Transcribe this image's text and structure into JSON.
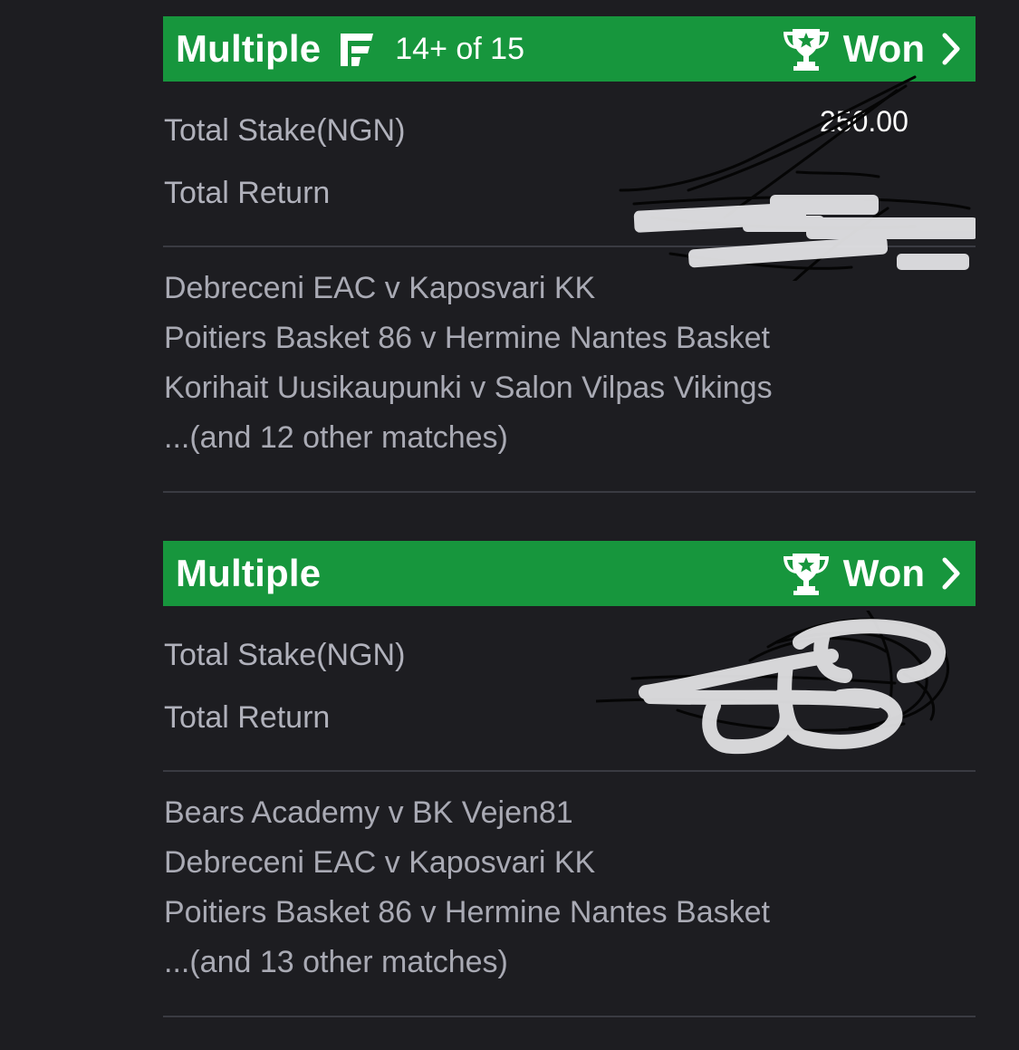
{
  "tickets": [
    {
      "bet_type": "Multiple",
      "flex_icon": "flex-cut-icon",
      "cut_text": "14+ of 15",
      "status_icon": "trophy-icon",
      "status": "Won",
      "stake_label": "Total Stake(NGN)",
      "stake_value_partial": "250.00",
      "return_label": "Total Return",
      "matches": [
        "Debreceni EAC v Kaposvari KK",
        "Poitiers Basket 86 v Hermine Nantes Basket",
        "Korihait Uusikaupunki v Salon Vilpas Vikings",
        "...(and 12 other matches)"
      ]
    },
    {
      "bet_type": "Multiple",
      "status_icon": "trophy-icon",
      "status": "Won",
      "stake_label": "Total Stake(NGN)",
      "return_label": "Total Return",
      "matches": [
        "Bears Academy v BK Vejen81",
        "Debreceni EAC v Kaposvari KK",
        "Poitiers Basket 86 v Hermine Nantes Basket",
        "...(and 13 other matches)"
      ]
    }
  ],
  "colors": {
    "background": "#1d1d21",
    "header_green": "#17963d",
    "text_muted": "#b0b1bb",
    "divider": "#3a3b42"
  }
}
